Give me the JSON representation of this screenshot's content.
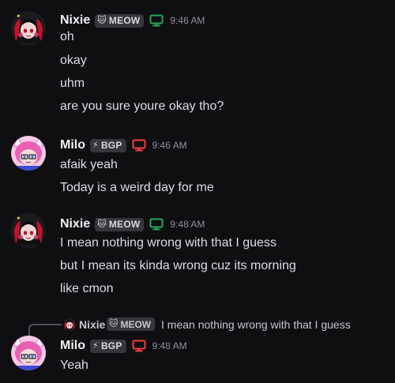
{
  "messages": [
    {
      "username": "Nixie",
      "tag": "MEOW",
      "tag_icon": "cat-face-icon",
      "device": "desktop-icon",
      "device_color": "#23a55a",
      "timestamp": "9:46 AM",
      "lines": [
        "oh",
        "okay",
        "uhm",
        "are you sure youre okay tho?"
      ]
    },
    {
      "username": "Milo",
      "tag": "BGP",
      "tag_icon": "lightning-icon",
      "device": "desktop-icon",
      "device_color": "#f23f43",
      "timestamp": "9:46 AM",
      "lines": [
        "afaik yeah",
        "Today is a weird day for me"
      ]
    },
    {
      "username": "Nixie",
      "tag": "MEOW",
      "tag_icon": "cat-face-icon",
      "device": "desktop-icon",
      "device_color": "#23a55a",
      "timestamp": "9:48 AM",
      "lines": [
        "I mean nothing wrong with that I guess",
        "but I mean its kinda wrong cuz its morning",
        "like cmon"
      ]
    },
    {
      "username": "Milo",
      "tag": "BGP",
      "tag_icon": "lightning-icon",
      "device": "desktop-icon",
      "device_color": "#f23f43",
      "timestamp": "9:48 AM",
      "lines": [
        "Yeah"
      ],
      "reply": {
        "username": "Nixie",
        "tag": "MEOW",
        "text": "I mean nothing wrong with that I guess"
      }
    }
  ],
  "colors": {
    "background": "#0f0f12",
    "text": "#dbdee1",
    "username": "#f2f3f5",
    "timestamp": "#8e9197",
    "tag_bg": "#36373d"
  }
}
